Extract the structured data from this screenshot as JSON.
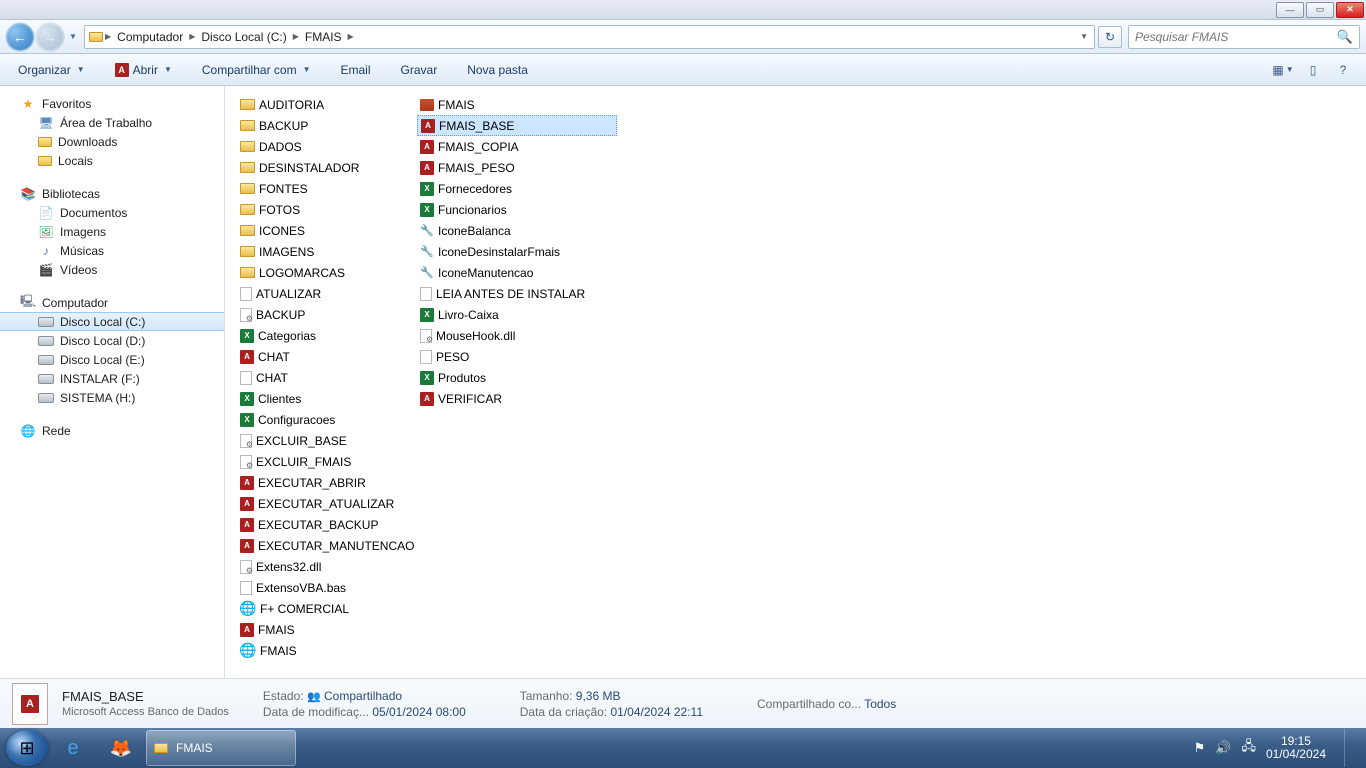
{
  "breadcrumb": [
    "Computador",
    "Disco Local (C:)",
    "FMAIS"
  ],
  "search": {
    "placeholder": "Pesquisar FMAIS"
  },
  "toolbar": {
    "organize": "Organizar",
    "open": "Abrir",
    "share": "Compartilhar com",
    "email": "Email",
    "burn": "Gravar",
    "newfolder": "Nova pasta"
  },
  "nav": {
    "favorites": "Favoritos",
    "desktop": "Área de Trabalho",
    "downloads": "Downloads",
    "recent": "Locais",
    "libraries": "Bibliotecas",
    "documents": "Documentos",
    "images": "Imagens",
    "music": "Músicas",
    "videos": "Vídeos",
    "computer": "Computador",
    "drive_c": "Disco Local (C:)",
    "drive_d": "Disco Local (D:)",
    "drive_e": "Disco Local (E:)",
    "drive_f": "INSTALAR (F:)",
    "drive_h": "SISTEMA (H:)",
    "network": "Rede"
  },
  "col1": [
    {
      "n": "AUDITORIA",
      "t": "folder"
    },
    {
      "n": "BACKUP",
      "t": "folder"
    },
    {
      "n": "DADOS",
      "t": "folder"
    },
    {
      "n": "DESINSTALADOR",
      "t": "folder"
    },
    {
      "n": "FONTES",
      "t": "folder"
    },
    {
      "n": "FOTOS",
      "t": "folder"
    },
    {
      "n": "ICONES",
      "t": "folder"
    },
    {
      "n": "IMAGENS",
      "t": "folder"
    },
    {
      "n": "LOGOMARCAS",
      "t": "folder"
    },
    {
      "n": "ATUALIZAR",
      "t": "txt"
    },
    {
      "n": "BACKUP",
      "t": "bat"
    },
    {
      "n": "Categorias",
      "t": "excel"
    },
    {
      "n": "CHAT",
      "t": "access"
    },
    {
      "n": "CHAT",
      "t": "txt"
    },
    {
      "n": "Clientes",
      "t": "excel"
    },
    {
      "n": "Configuracoes",
      "t": "excel"
    },
    {
      "n": "EXCLUIR_BASE",
      "t": "bat"
    },
    {
      "n": "EXCLUIR_FMAIS",
      "t": "bat"
    },
    {
      "n": "EXECUTAR_ABRIR",
      "t": "access"
    },
    {
      "n": "EXECUTAR_ATUALIZAR",
      "t": "access"
    },
    {
      "n": "EXECUTAR_BACKUP",
      "t": "access"
    },
    {
      "n": "EXECUTAR_MANUTENCAO",
      "t": "access"
    },
    {
      "n": "Extens32.dll",
      "t": "dll"
    },
    {
      "n": "ExtensoVBA.bas",
      "t": "txt"
    },
    {
      "n": "F+ COMERCIAL",
      "t": "globe"
    },
    {
      "n": "FMAIS",
      "t": "access"
    },
    {
      "n": "FMAIS",
      "t": "globe"
    }
  ],
  "col2": [
    {
      "n": "FMAIS",
      "t": "img"
    },
    {
      "n": "FMAIS_BASE",
      "t": "access",
      "sel": true
    },
    {
      "n": "FMAIS_COPIA",
      "t": "access"
    },
    {
      "n": "FMAIS_PESO",
      "t": "access"
    },
    {
      "n": "Fornecedores",
      "t": "excel"
    },
    {
      "n": "Funcionarios",
      "t": "excel"
    },
    {
      "n": "IconeBalanca",
      "t": "ico"
    },
    {
      "n": "IconeDesinstalarFmais",
      "t": "ico"
    },
    {
      "n": "IconeManutencao",
      "t": "ico"
    },
    {
      "n": "LEIA ANTES DE INSTALAR",
      "t": "txt"
    },
    {
      "n": "Livro-Caixa",
      "t": "excel"
    },
    {
      "n": "MouseHook.dll",
      "t": "dll"
    },
    {
      "n": "PESO",
      "t": "txt"
    },
    {
      "n": "Produtos",
      "t": "excel"
    },
    {
      "n": "VERIFICAR",
      "t": "access"
    }
  ],
  "details": {
    "name": "FMAIS_BASE",
    "type": "Microsoft Access Banco de Dados",
    "state_label": "Estado:",
    "state": "Compartilhado",
    "mod_label": "Data de modificaç...",
    "mod": "05/01/2024 08:00",
    "size_label": "Tamanho:",
    "size": "9,36 MB",
    "created_label": "Data da criação:",
    "created": "01/04/2024 22:11",
    "shared_label": "Compartilhado co...",
    "shared": "Todos"
  },
  "taskbar": {
    "app": "FMAIS",
    "time": "19:15",
    "date": "01/04/2024"
  }
}
